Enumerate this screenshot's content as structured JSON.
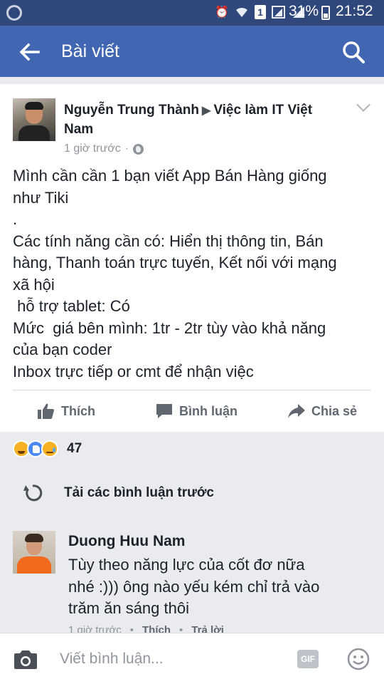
{
  "status_bar": {
    "battery_percent": "31%",
    "time": "21:52",
    "sim_indicator": "1"
  },
  "app_bar": {
    "title": "Bài viết",
    "back_icon": "arrow-left-icon",
    "search_icon": "search-icon"
  },
  "post": {
    "author": "Nguyễn Trung Thành",
    "group": "Việc làm IT Việt Nam",
    "time": "1 giờ trước",
    "privacy_icon": "globe-icon",
    "lines": [
      "Mình cần cần 1 bạn viết App Bán Hàng giống",
      "như Tiki",
      ".",
      "Các tính năng cần có: Hiển thị thông tin, Bán",
      "hàng, Thanh toán trực tuyến, Kết nối với mạng",
      "xã hội",
      " hỗ trợ tablet: Có",
      "Mức  giá bên mình: 1tr - 2tr tùy vào khả năng",
      "của bạn coder",
      "Inbox trực tiếp or cmt để nhận việc"
    ],
    "actions": {
      "like": "Thích",
      "comment": "Bình luận",
      "share": "Chia sẻ"
    }
  },
  "reactions": {
    "icons": [
      "haha-reaction",
      "like-reaction",
      "sad-reaction"
    ],
    "count": "47"
  },
  "load_previous": "Tải các bình luận trước",
  "comment": {
    "name": "Duong Huu Nam",
    "lines": [
      "Tùy theo năng lực của cốt đơ nữa",
      "nhé :))) ông nào yếu kém chỉ trả vào",
      "trăm ăn sáng thôi"
    ],
    "time": "1 giờ trước",
    "like": "Thích",
    "reply": "Trả lời"
  },
  "composer": {
    "placeholder": "Viết bình luận...",
    "gif_label": "GIF"
  },
  "colors": {
    "facebook_blue": "#4267b2",
    "status_bar": "#2f477a",
    "action_gray": "#606770"
  }
}
